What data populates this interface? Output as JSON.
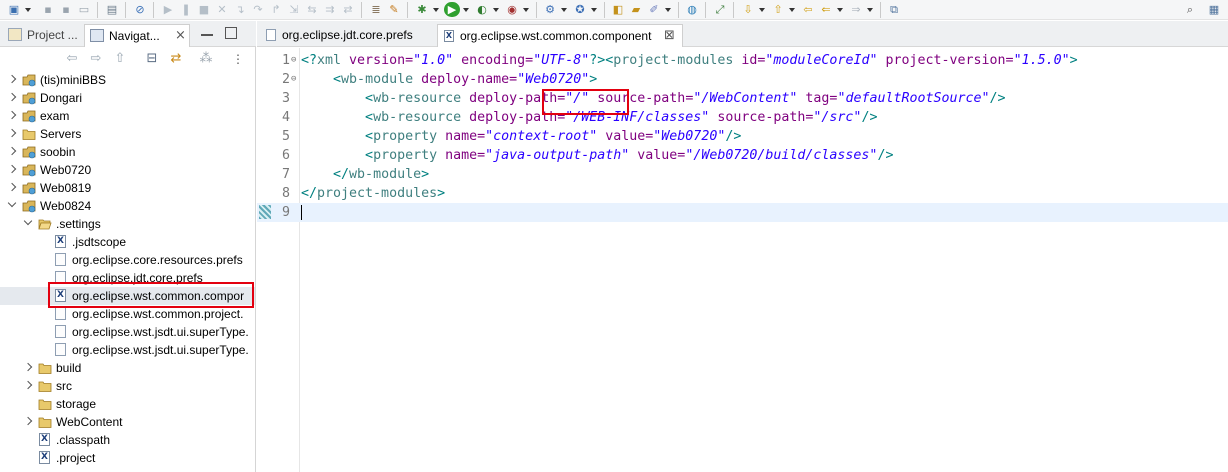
{
  "left_panel": {
    "tabs": [
      {
        "label": "Project ...",
        "active": false
      },
      {
        "label": "Navigat...",
        "active": true
      }
    ],
    "tree": [
      {
        "label": "(tis)miniBBS",
        "depth": 0,
        "type": "project",
        "expanded": false
      },
      {
        "label": "Dongari",
        "depth": 0,
        "type": "project",
        "expanded": false
      },
      {
        "label": "exam",
        "depth": 0,
        "type": "project",
        "expanded": false
      },
      {
        "label": "Servers",
        "depth": 0,
        "type": "folder",
        "expanded": false
      },
      {
        "label": "soobin",
        "depth": 0,
        "type": "project",
        "expanded": false
      },
      {
        "label": "Web0720",
        "depth": 0,
        "type": "project",
        "expanded": false
      },
      {
        "label": "Web0819",
        "depth": 0,
        "type": "project",
        "expanded": false
      },
      {
        "label": "Web0824",
        "depth": 0,
        "type": "project",
        "expanded": true
      },
      {
        "label": ".settings",
        "depth": 1,
        "type": "folder-open",
        "expanded": true
      },
      {
        "label": ".jsdtscope",
        "depth": 2,
        "type": "xfile"
      },
      {
        "label": "org.eclipse.core.resources.prefs",
        "depth": 2,
        "type": "file"
      },
      {
        "label": "org.eclipse.jdt.core.prefs",
        "depth": 2,
        "type": "file"
      },
      {
        "label": "org.eclipse.wst.common.compor",
        "depth": 2,
        "type": "xfile",
        "selected": true
      },
      {
        "label": "org.eclipse.wst.common.project.",
        "depth": 2,
        "type": "file"
      },
      {
        "label": "org.eclipse.wst.jsdt.ui.superType.",
        "depth": 2,
        "type": "file"
      },
      {
        "label": "org.eclipse.wst.jsdt.ui.superType.",
        "depth": 2,
        "type": "file"
      },
      {
        "label": "build",
        "depth": 1,
        "type": "folder",
        "expanded": false
      },
      {
        "label": "src",
        "depth": 1,
        "type": "folder",
        "expanded": false
      },
      {
        "label": "storage",
        "depth": 1,
        "type": "folder",
        "leaf": true
      },
      {
        "label": "WebContent",
        "depth": 1,
        "type": "folder",
        "expanded": false
      },
      {
        "label": ".classpath",
        "depth": 1,
        "type": "xfile"
      },
      {
        "label": ".project",
        "depth": 1,
        "type": "xfile"
      }
    ]
  },
  "editor": {
    "tabs": [
      {
        "label": "org.eclipse.jdt.core.prefs",
        "active": false
      },
      {
        "label": "org.eclipse.wst.common.component",
        "active": true,
        "close": "⊠"
      }
    ],
    "lines": [
      {
        "n": "1",
        "fold": "⊖",
        "tokens": [
          [
            "pi",
            "<?"
          ],
          [
            "tag",
            "xml "
          ],
          [
            "attr",
            "version="
          ],
          [
            "val",
            "\"1.0\""
          ],
          [
            "attr",
            " encoding="
          ],
          [
            "val",
            "\"UTF-8\""
          ],
          [
            "pi",
            "?>"
          ],
          [
            "bracket",
            "<"
          ],
          [
            "tag",
            "project-modules "
          ],
          [
            "attr",
            "id="
          ],
          [
            "val",
            "\"moduleCoreId\""
          ],
          [
            "attr",
            " project-version="
          ],
          [
            "val",
            "\"1.5.0\""
          ],
          [
            "bracket",
            ">"
          ]
        ]
      },
      {
        "n": "2",
        "fold": "⊖",
        "tokens": [
          [
            "tag",
            "    "
          ],
          [
            "bracket",
            "<"
          ],
          [
            "tag",
            "wb-module "
          ],
          [
            "attr",
            "deploy-name="
          ],
          [
            "val",
            "\"Web0720\""
          ],
          [
            "bracket",
            ">"
          ]
        ]
      },
      {
        "n": "3",
        "fold": "",
        "tokens": [
          [
            "tag",
            "        "
          ],
          [
            "bracket",
            "<"
          ],
          [
            "tag",
            "wb-resource "
          ],
          [
            "attr",
            "deploy-path="
          ],
          [
            "val",
            "\"/\""
          ],
          [
            "attr",
            " source-path="
          ],
          [
            "val",
            "\"/WebContent\""
          ],
          [
            "attr",
            " tag="
          ],
          [
            "val",
            "\"defaultRootSource\""
          ],
          [
            "bracket",
            "/>"
          ]
        ]
      },
      {
        "n": "4",
        "fold": "",
        "tokens": [
          [
            "tag",
            "        "
          ],
          [
            "bracket",
            "<"
          ],
          [
            "tag",
            "wb-resource "
          ],
          [
            "attr",
            "deploy-path="
          ],
          [
            "val",
            "\"/WEB-INF/classes\""
          ],
          [
            "attr",
            " source-path="
          ],
          [
            "val",
            "\"/src\""
          ],
          [
            "bracket",
            "/>"
          ]
        ]
      },
      {
        "n": "5",
        "fold": "",
        "tokens": [
          [
            "tag",
            "        "
          ],
          [
            "bracket",
            "<"
          ],
          [
            "tag",
            "property "
          ],
          [
            "attr",
            "name="
          ],
          [
            "val",
            "\"context-root\""
          ],
          [
            "attr",
            " value="
          ],
          [
            "val",
            "\"Web0720\""
          ],
          [
            "bracket",
            "/>"
          ]
        ]
      },
      {
        "n": "6",
        "fold": "",
        "tokens": [
          [
            "tag",
            "        "
          ],
          [
            "bracket",
            "<"
          ],
          [
            "tag",
            "property "
          ],
          [
            "attr",
            "name="
          ],
          [
            "val",
            "\"java-output-path\""
          ],
          [
            "attr",
            " value="
          ],
          [
            "val",
            "\"/Web0720/build/classes\""
          ],
          [
            "bracket",
            "/>"
          ]
        ]
      },
      {
        "n": "7",
        "fold": "",
        "tokens": [
          [
            "tag",
            "    "
          ],
          [
            "bracket",
            "</"
          ],
          [
            "tag",
            "wb-module"
          ],
          [
            "bracket",
            ">"
          ]
        ]
      },
      {
        "n": "8",
        "fold": "",
        "tokens": [
          [
            "bracket",
            "</"
          ],
          [
            "tag",
            "project-modules"
          ],
          [
            "bracket",
            ">"
          ]
        ]
      },
      {
        "n": "9",
        "fold": "",
        "tokens": [],
        "current": true
      }
    ]
  },
  "colors": {
    "highlight_box": "#e3000f",
    "current_line": "#e8f2fe",
    "xml_tag": "#3f7f7f",
    "xml_attr": "#7f007f",
    "xml_value": "#2a00ff"
  },
  "icons": {
    "toolbar": [
      "new-icon",
      "save-icon",
      "save-all-icon",
      "print-icon",
      "terminal-icon",
      "skip-breakpoints-icon",
      "resume-icon",
      "suspend-icon",
      "terminate-icon",
      "disconnect-icon",
      "step-into-icon",
      "step-over-icon",
      "step-return-icon",
      "drop-to-frame-icon",
      "use-step-filters-icon",
      "debug-icon",
      "run-icon",
      "coverage-icon",
      "run-server-icon",
      "new-server-icon",
      "new-java-class-icon",
      "open-type-icon",
      "open-task-icon",
      "build-icon",
      "globe-icon",
      "pin-icon",
      "next-annotation-icon",
      "prev-annotation-icon",
      "last-edit-icon",
      "back-icon",
      "forward-icon",
      "perspective-icon",
      "search-icon"
    ]
  }
}
